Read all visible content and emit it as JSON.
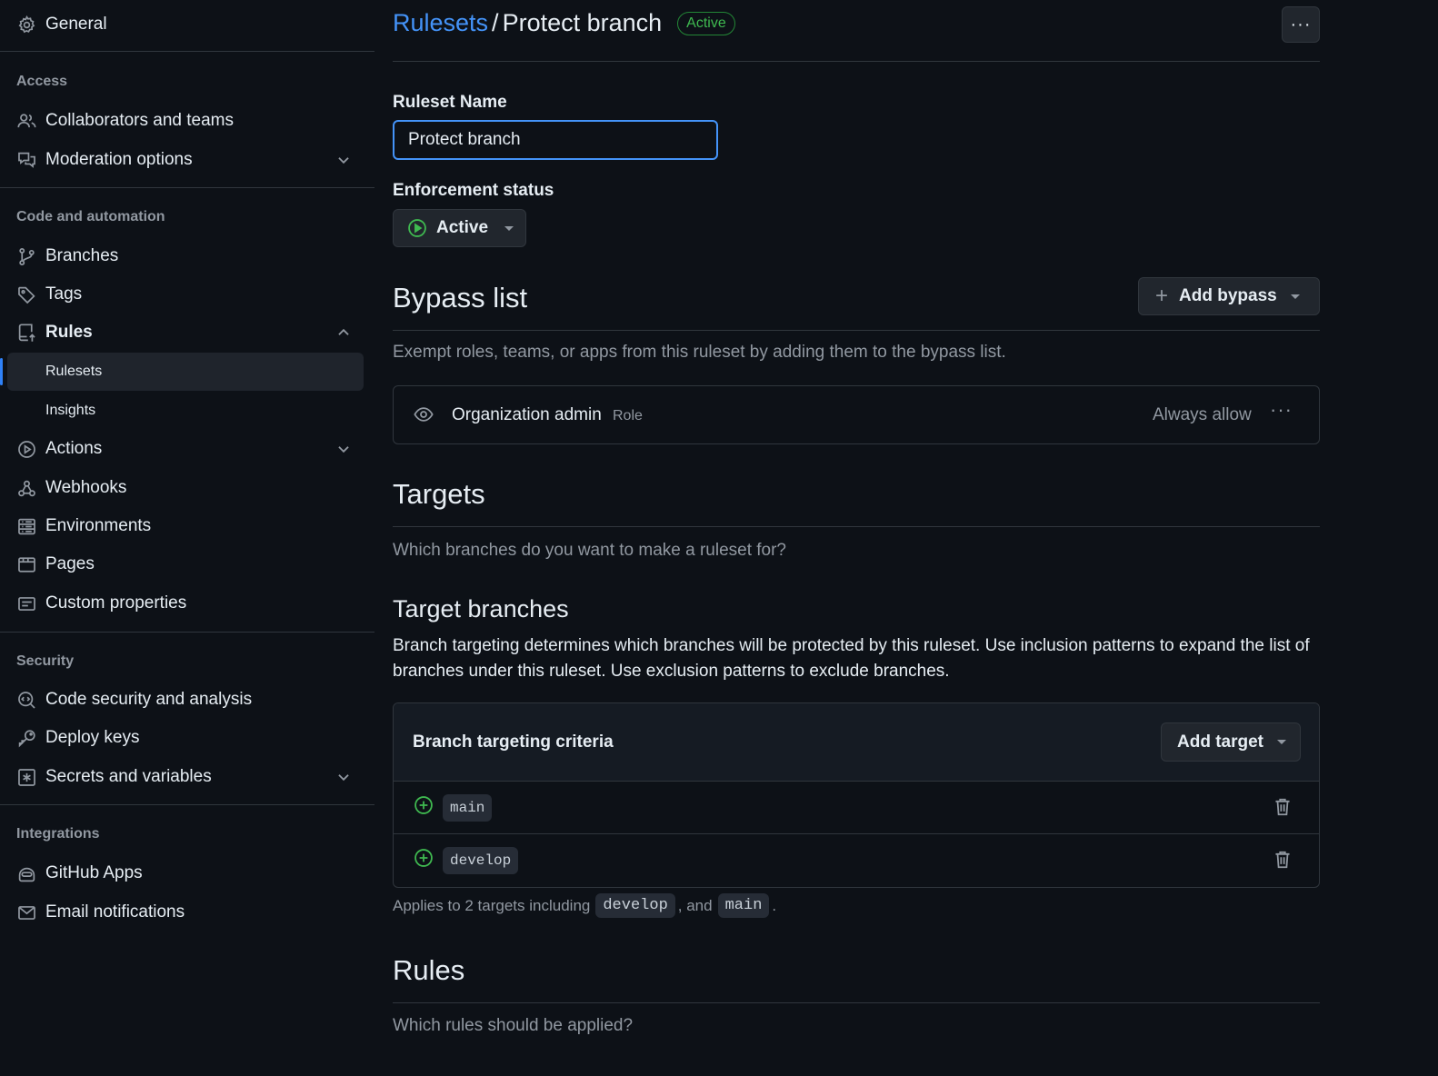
{
  "sidebar": {
    "general": "General",
    "access_heading": "Access",
    "collaborators": "Collaborators and teams",
    "moderation": "Moderation options",
    "code_heading": "Code and automation",
    "branches": "Branches",
    "tags": "Tags",
    "rules": "Rules",
    "rulesets": "Rulesets",
    "insights": "Insights",
    "actions": "Actions",
    "webhooks": "Webhooks",
    "environments": "Environments",
    "pages": "Pages",
    "custom_properties": "Custom properties",
    "security_heading": "Security",
    "code_security": "Code security and analysis",
    "deploy_keys": "Deploy keys",
    "secrets": "Secrets and variables",
    "integrations_heading": "Integrations",
    "github_apps": "GitHub Apps",
    "email_notifications": "Email notifications"
  },
  "header": {
    "crumb_link": "Rulesets",
    "crumb_sep": "/",
    "crumb_current": "Protect branch",
    "status_badge": "Active"
  },
  "ruleset_name": {
    "label": "Ruleset Name",
    "value": "Protect branch"
  },
  "enforcement": {
    "label": "Enforcement status",
    "value": "Active"
  },
  "bypass": {
    "title": "Bypass list",
    "add_button": "Add bypass",
    "description": "Exempt roles, teams, or apps from this ruleset by adding them to the bypass list.",
    "entry_name": "Organization admin",
    "entry_type": "Role",
    "entry_mode": "Always allow"
  },
  "targets": {
    "title": "Targets",
    "description": "Which branches do you want to make a ruleset for?",
    "subtitle": "Target branches",
    "long_desc": "Branch targeting determines which branches will be protected by this ruleset. Use inclusion patterns to expand the list of branches under this ruleset. Use exclusion patterns to exclude branches.",
    "criteria_title": "Branch targeting criteria",
    "add_target": "Add target",
    "rows": [
      "main",
      "develop"
    ],
    "applies_prefix": "Applies to 2 targets including",
    "applies_code1": "develop",
    "applies_mid": ", and",
    "applies_code2": "main",
    "applies_end": "."
  },
  "rules": {
    "title": "Rules",
    "description": "Which rules should be applied?"
  },
  "colors": {
    "background": "#0d1117",
    "accent": "#4493f8",
    "success": "#3fb950",
    "border": "#30363d"
  }
}
